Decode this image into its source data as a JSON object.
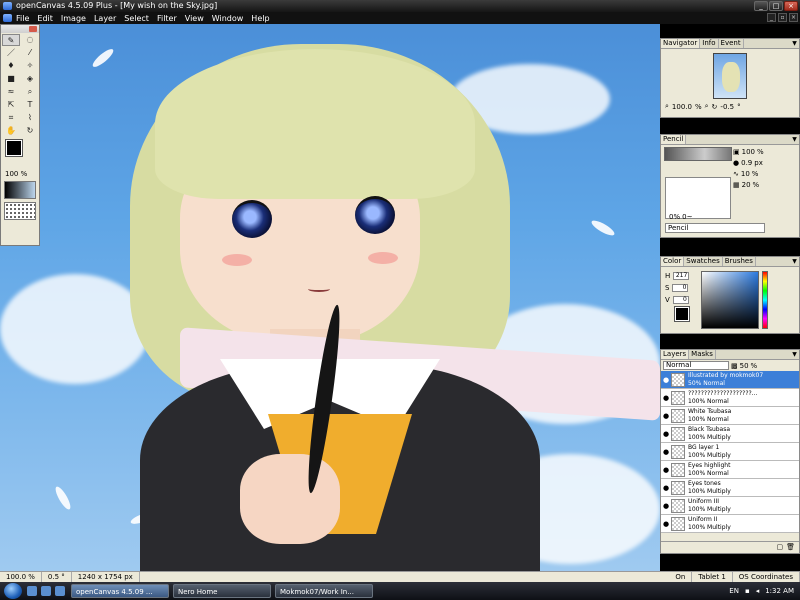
{
  "window": {
    "title": "openCanvas 4.5.09 Plus - [My wish on the Sky.jpg]"
  },
  "menu": {
    "items": [
      "File",
      "Edit",
      "Image",
      "Layer",
      "Select",
      "Filter",
      "View",
      "Window",
      "Help"
    ]
  },
  "toolbox": {
    "zoom_value": "100",
    "zoom_unit": "%"
  },
  "navigator": {
    "tabs": [
      "Navigator",
      "Info",
      "Event"
    ],
    "zoom": "100.0",
    "zoom_unit": "%",
    "rotation": "-0.5",
    "rotation_unit": "°"
  },
  "pencil": {
    "tab": "Pencil",
    "opacity": "100",
    "opacity_unit": "%",
    "size": "0.9",
    "size_unit": "px",
    "row3": "10",
    "row3_unit": "%",
    "row4": "20",
    "row4_unit": "%",
    "percent": "0%",
    "tilde": "0~",
    "brush_name": "Pencil"
  },
  "color_panel": {
    "tabs": [
      "Color",
      "Swatches",
      "Brushes"
    ],
    "h_label": "H",
    "h": "217",
    "s_label": "S",
    "s": "0",
    "v_label": "V",
    "v": "0"
  },
  "layers": {
    "tabs": [
      "Layers",
      "Masks"
    ],
    "blend_mode": "Normal",
    "opacity": "50",
    "opacity_unit": "%",
    "items": [
      {
        "name": "Illustrated by mokmok07",
        "mode": "50% Normal"
      },
      {
        "name": "????????????????????...",
        "mode": "100% Normal"
      },
      {
        "name": "White Tsubasa",
        "mode": "100% Normal"
      },
      {
        "name": "Black Tsubasa",
        "mode": "100% Multiply"
      },
      {
        "name": "BG layer 1",
        "mode": "100% Multiply"
      },
      {
        "name": "Eyes highlight",
        "mode": "100% Normal"
      },
      {
        "name": "Eyes tones",
        "mode": "100% Multiply"
      },
      {
        "name": "Uniform III",
        "mode": "100% Multiply"
      },
      {
        "name": "Uniform II",
        "mode": "100% Multiply"
      }
    ]
  },
  "status": {
    "zoom": "100.0 %",
    "angle": "0.5 °",
    "dimensions": "1240 x 1754 px",
    "on": "On",
    "tablet": "Tablet 1",
    "coords": "OS Coordinates"
  },
  "taskbar": {
    "tasks": [
      "openCanvas 4.5.09 ...",
      "Nero Home",
      "Mokmok07/Work In..."
    ],
    "lang": "EN",
    "time": "1:32 AM"
  },
  "colors": {
    "accent": "#3c7fd8",
    "sky": "#5ea5e6"
  }
}
